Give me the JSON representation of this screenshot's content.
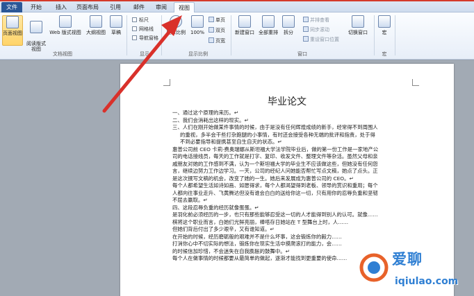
{
  "tabs": [
    {
      "label": "文件"
    },
    {
      "label": "开始"
    },
    {
      "label": "插入"
    },
    {
      "label": "页面布局"
    },
    {
      "label": "引用"
    },
    {
      "label": "邮件"
    },
    {
      "label": "审阅"
    },
    {
      "label": "视图"
    }
  ],
  "ribbon": {
    "views": {
      "page_view": "页面视图",
      "reading_view": "阅读版式\n视图",
      "web_view": "Web 版式视图",
      "outline": "大纲视图",
      "draft": "草稿",
      "group_label": "文档视图"
    },
    "show": {
      "ruler": "标尺",
      "gridlines": "网格线",
      "nav_pane": "导航窗格",
      "group_label": "显示"
    },
    "zoom": {
      "zoom": "显示比例",
      "percent": "100%",
      "one_page": "单页",
      "two_pages": "双页",
      "page_width": "页宽",
      "group_label": "显示比例"
    },
    "window": {
      "new_window": "新建窗口",
      "arrange_all": "全部重排",
      "split": "拆分",
      "side_by_side": "并排查看",
      "sync_scroll": "同步滚动",
      "reset_position": "重设窗口位置",
      "switch_windows": "切换窗口",
      "group_label": "窗口"
    },
    "macros": {
      "macros": "宏",
      "group_label": "宏"
    }
  },
  "document": {
    "title": "毕业论文",
    "lines": [
      "一、通过这个原理的来历。↵",
      "二、我们会消耗出这样的现实。↵",
      "三、人们在刚开始做某件事情的时候，由于是没有任何辉煌成绩的新手，经常得不到周围人",
      "的重视，多半会干些打杂跑腿的小事情，有时还会接受各种无端的批评和指责，处于得",
      "不到必要指导和提携甚至自生自灭的状态。↵",
      "惠普公司前 CEO 卡莉·费奥瑞娜从斯坦福大学法学院毕业后，做的第一份工作是一家地产公",
      "司的电话接线员，每天的工作就是打字、复印、收发文件、整理文件等杂活。虽然父母和亲",
      "戚朋友对她的工作感到不满，认为一个斯坦福大学的毕业生不应该做这些，但她没有任何怨",
      "言，继续边努力工作边学习。一天，公司的经纪人问她能否帮忙写点文稿，她点了点头。正",
      "是这次撰写文稿的机会，改变了她的一生。她后来发展成为惠普公司的 CEO。↵",
      "每个人都希望生活如诗如画、如愿得求，每个人都渴望得到老板、领导的赏识和重用；每个",
      "人都向往事业走升、飞黄腾达但没有谁会白白的送给你这一切，只有用你的忍辱负重和坚韧",
      "不屈去赢取。↵",
      "四、这段忍辱负重的经历就像蛋蛋。↵",
      "是羽化前必须经历的一步，也只有那些能够忍受这一切的人才能得到别人的认可。就像……",
      "棋将这个职业而言，白她们光鲜亮丽，棒嗒存日她站在 T 型舞台上时，人……",
      "但她们背后付出了多少艰辛，又有谁知道。↵",
      "在开始的时候，经历磨砺般的艰难并不是什么坏事，这会锻炼你的毅力……",
      "打消你心中不切实际的想法，锻炼你在现实生活中摸爬滚打的能力，会……",
      "的时候信加珍惜，不会迷失在自我膨胀的鼓舞中。↵",
      "每个人在做事情的时候都要从最简单的做起，逐渐才能找到更重要的使命……"
    ]
  },
  "watermark": {
    "chinese": "爱聊",
    "url": "iqiulao.com"
  },
  "colors": {
    "file_tab": "#2b5797",
    "annotation_arrow": "#d9312b",
    "watermark": "#2f7fd3"
  }
}
